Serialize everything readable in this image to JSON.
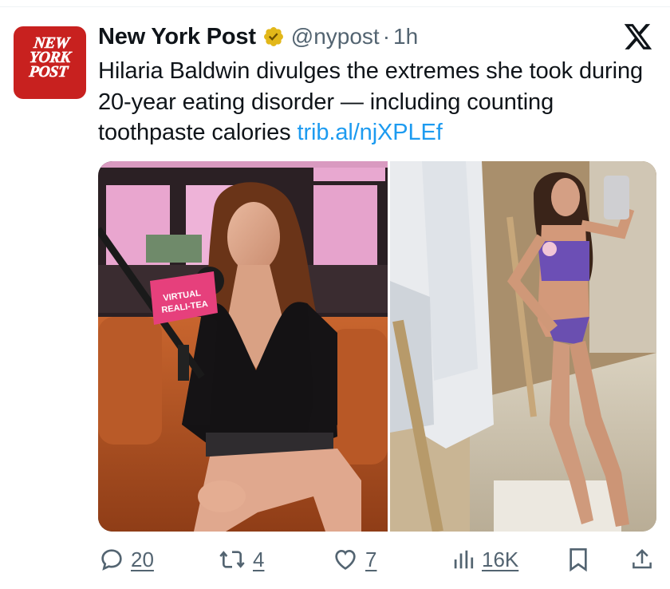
{
  "tweet": {
    "author_name": "New York Post",
    "handle": "@nypost",
    "separator": "·",
    "time": "1h",
    "text": "Hilaria Baldwin divulges the extremes she took during 20-year eating disorder — including counting toothpaste calories ",
    "link": "trib.al/njXPLEf",
    "avatar_logo": [
      "NEW",
      "YORK",
      "POST"
    ],
    "verified_color": "#e2b719",
    "media_overlay_text": [
      "VIRTUAL",
      "REALI-TEA"
    ]
  },
  "actions": {
    "replies": "20",
    "retweets": "4",
    "likes": "7",
    "views": "16K"
  },
  "icons": [
    "verified-badge-icon",
    "x-logo-icon",
    "reply-icon",
    "retweet-icon",
    "like-icon",
    "views-icon",
    "bookmark-icon",
    "share-icon"
  ]
}
